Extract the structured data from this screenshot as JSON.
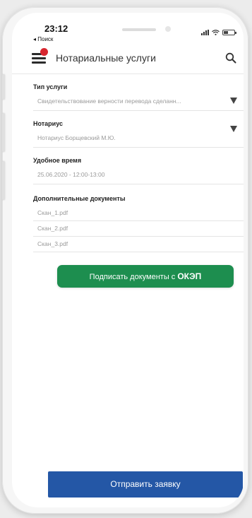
{
  "status_bar": {
    "time": "23:12",
    "back_link": "◂ Поиск"
  },
  "header": {
    "title": "Нотариальные услуги",
    "menu_icon": "hamburger-menu-icon",
    "search_icon": "search-icon",
    "badge_color": "#d8262f"
  },
  "form": {
    "service_type": {
      "label": "Тип услуги",
      "value": "Свидетельствование верности перевода сделанн..."
    },
    "notary": {
      "label": "Нотариус",
      "value": "Нотариус Борщевский М.Ю."
    },
    "preferred_time": {
      "label": "Удобное время",
      "value": "25.06.2020 - 12:00-13:00"
    },
    "documents": {
      "label": "Дополнительные документы",
      "items": [
        "Скан_1.pdf",
        "Скан_2.pdf",
        "Скан_3.pdf"
      ]
    }
  },
  "sign_button": {
    "label_prefix": "Подписать документы с ",
    "label_bold": "ОКЭП",
    "color": "#1d8e4f"
  },
  "submit_button": {
    "label": "Отправить заявку",
    "color": "#2457a6"
  }
}
